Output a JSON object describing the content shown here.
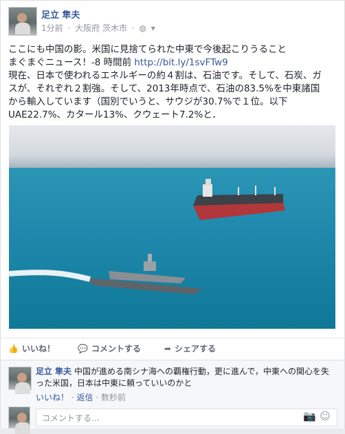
{
  "post": {
    "author": "足立 隼夫",
    "time": "1分前",
    "location": "大阪府 茨木市",
    "visibility_icon": "world-icon",
    "text_line1": "ここにも中国の影。米国に見捨てられた中東で今後起こりうること",
    "text_line2a": "まぐまぐニュース！-8 時間前 ",
    "link": "http://bit.ly/1svFTw9",
    "text_line3": "現在、日本で使われるエネルギーの約４割は、石油です。そして、石炭、ガ",
    "text_line4": "スが、それぞれ２割強。そして、2013年時点で、石油の83.5%を中東諸国",
    "text_line5": "から輸入しています（国別でいうと、サウジが30.7%で１位。以下",
    "text_line6": "UAE22.7%、カタール13%、クウェート7.2%と．"
  },
  "actions": {
    "like": "いいね！",
    "comment": "コメントする",
    "share": "シェアする"
  },
  "comment": {
    "author": "足立 隼夫",
    "text": "中国が進める南シナ海への覇権行動，更に進んで，中東への関心を失った米国，日本は中東に頼っていいのかと",
    "like": "いいね！",
    "reply": "返信",
    "time": "数秒前"
  },
  "input": {
    "placeholder": "コメントする..."
  }
}
